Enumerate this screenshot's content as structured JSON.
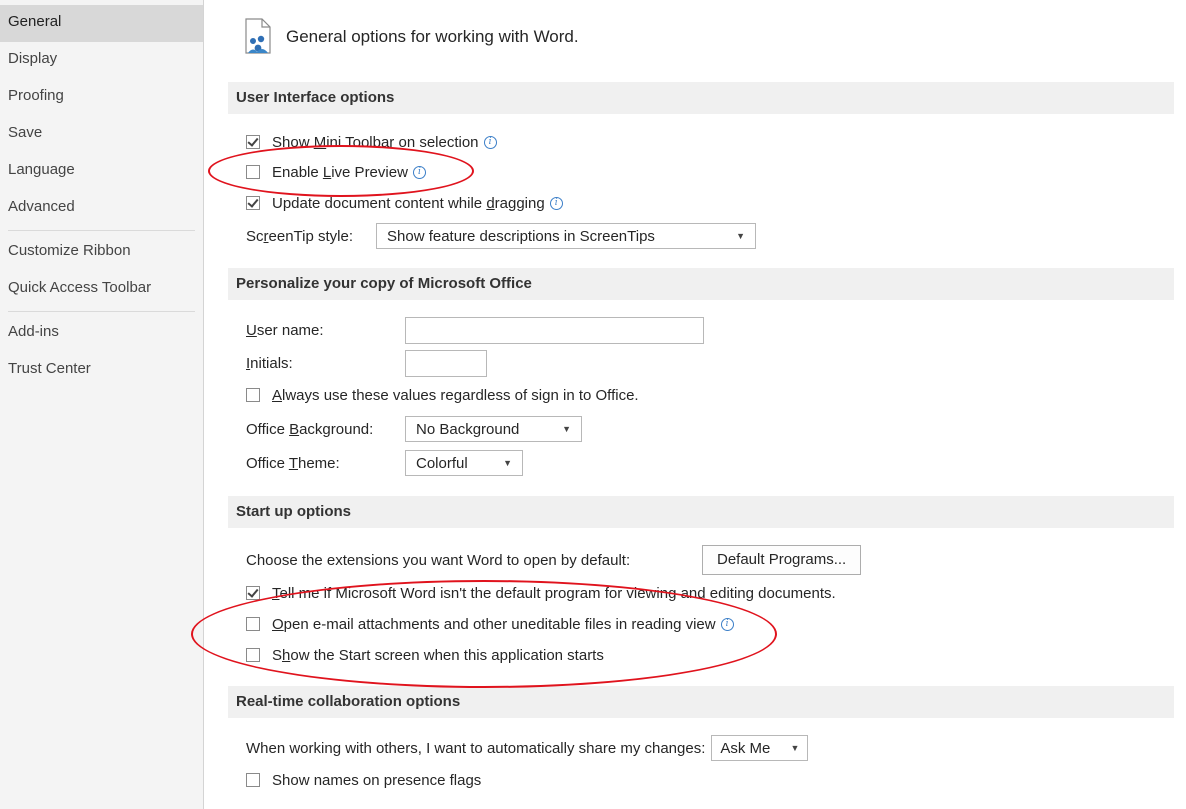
{
  "sidebar": {
    "items": [
      "General",
      "Display",
      "Proofing",
      "Save",
      "Language",
      "Advanced",
      "Customize Ribbon",
      "Quick Access Toolbar",
      "Add-ins",
      "Trust Center"
    ]
  },
  "header": {
    "title": "General options for working with Word."
  },
  "sections": {
    "ui": "User Interface options",
    "personalize": "Personalize your copy of Microsoft Office",
    "startup": "Start up options",
    "realtime": "Real-time collaboration options"
  },
  "ui": {
    "mini_toolbar": {
      "pre": "Show ",
      "u": "M",
      "post": "ini Toolbar on selection"
    },
    "live_preview": {
      "pre": "Enable ",
      "u": "L",
      "post": "ive Preview"
    },
    "update_content": {
      "pre": "Update document content while ",
      "u": "d",
      "post": "ragging"
    },
    "screentip_label": {
      "pre": "Sc",
      "u": "r",
      "post": "eenTip style:"
    },
    "screentip_value": "Show feature descriptions in ScreenTips"
  },
  "personalize": {
    "username_label": {
      "u": "U",
      "post": "ser name:"
    },
    "initials_label": {
      "u": "I",
      "post": "nitials:"
    },
    "always_use": {
      "u": "A",
      "post": "lways use these values regardless of sign in to Office."
    },
    "background_label": {
      "pre": "Office ",
      "u": "B",
      "post": "ackground:"
    },
    "background_value": "No Background",
    "theme_label": {
      "pre": "Office ",
      "u": "T",
      "post": "heme:"
    },
    "theme_value": "Colorful"
  },
  "startup": {
    "extensions_text": "Choose the extensions you want Word to open by default:",
    "default_programs": "Default Programs...",
    "tell_me": {
      "u": "T",
      "post": "ell me if Microsoft Word isn't the default program for viewing and editing documents."
    },
    "open_email": {
      "u": "O",
      "post": "pen e-mail attachments and other uneditable files in reading view"
    },
    "show_start": {
      "pre": "S",
      "u": "h",
      "post": "ow the Start screen when this application starts"
    }
  },
  "realtime": {
    "share_text": "When working with others, I want to automatically share my changes:",
    "share_value": "Ask Me",
    "presence_flags": "Show names on presence flags"
  },
  "colors": {
    "annotation": "#e0131d",
    "info_icon": "#3c7fc8",
    "section_bg": "#f0f0f0"
  }
}
